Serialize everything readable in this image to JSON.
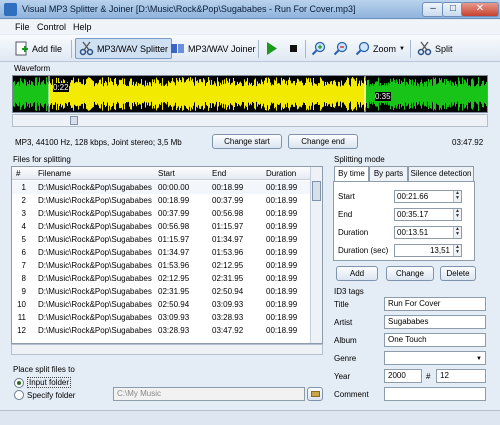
{
  "window": {
    "title": "Visual MP3 Splitter & Joiner [D:\\Music\\Rock&Pop\\Sugababes - Run For Cover.mp3]",
    "minimize": "–",
    "maximize": "□",
    "close": "✕"
  },
  "menu": [
    "File",
    "Control",
    "Help"
  ],
  "toolbar": {
    "add_file": "Add file",
    "splitter": "MP3/WAV Splitter",
    "joiner": "MP3/WAV Joiner",
    "zoom": "Zoom",
    "split": "Split"
  },
  "waveform": {
    "label": "Waveform",
    "start_marker": "0:22",
    "end_marker": "0:35",
    "selection_start_fraction": 0.075,
    "selection_end_fraction": 0.743,
    "colors": {
      "background": "#000000",
      "selected": "#f2ea00",
      "unselected": "#19c419"
    }
  },
  "info": {
    "format": "MP3, 44100 Hz, 128 kbps, Joint stereo; 3,5 Mb",
    "change_start": "Change start",
    "change_end": "Change end",
    "total": "03:47.92"
  },
  "files": {
    "label": "Files for splitting",
    "columns": [
      "#",
      "Filename",
      "Start",
      "End",
      "Duration"
    ],
    "rows": [
      [
        "1",
        "D:\\Music\\Rock&Pop\\Sugababes",
        "00:00.00",
        "00:18.99",
        "00:18.99"
      ],
      [
        "2",
        "D:\\Music\\Rock&Pop\\Sugababes",
        "00:18.99",
        "00:37.99",
        "00:18.99"
      ],
      [
        "3",
        "D:\\Music\\Rock&Pop\\Sugababes",
        "00:37.99",
        "00:56.98",
        "00:18.99"
      ],
      [
        "4",
        "D:\\Music\\Rock&Pop\\Sugababes",
        "00:56.98",
        "01:15.97",
        "00:18.99"
      ],
      [
        "5",
        "D:\\Music\\Rock&Pop\\Sugababes",
        "01:15.97",
        "01:34.97",
        "00:18.99"
      ],
      [
        "6",
        "D:\\Music\\Rock&Pop\\Sugababes",
        "01:34.97",
        "01:53.96",
        "00:18.99"
      ],
      [
        "7",
        "D:\\Music\\Rock&Pop\\Sugababes",
        "01:53.96",
        "02:12.95",
        "00:18.99"
      ],
      [
        "8",
        "D:\\Music\\Rock&Pop\\Sugababes",
        "02:12.95",
        "02:31.95",
        "00:18.99"
      ],
      [
        "9",
        "D:\\Music\\Rock&Pop\\Sugababes",
        "02:31.95",
        "02:50.94",
        "00:18.99"
      ],
      [
        "10",
        "D:\\Music\\Rock&Pop\\Sugababes",
        "02:50.94",
        "03:09.93",
        "00:18.99"
      ],
      [
        "11",
        "D:\\Music\\Rock&Pop\\Sugababes",
        "03:09.93",
        "03:28.93",
        "00:18.99"
      ],
      [
        "12",
        "D:\\Music\\Rock&Pop\\Sugababes",
        "03:28.93",
        "03:47.92",
        "00:18.99"
      ]
    ]
  },
  "splitting": {
    "label": "Splitting mode",
    "tabs": [
      "By time",
      "By parts",
      "Silence detection"
    ],
    "start_label": "Start",
    "start_value": "00:21.66",
    "end_label": "End",
    "end_value": "00:35.17",
    "duration_label": "Duration",
    "duration_value": "00:13.51",
    "duration_sec_label": "Duration (sec)",
    "duration_sec_value": "13,51",
    "add": "Add",
    "change": "Change",
    "delete": "Delete"
  },
  "id3": {
    "label": "ID3 tags",
    "title_label": "Title",
    "title_value": "Run For Cover",
    "artist_label": "Artist",
    "artist_value": "Sugababes",
    "album_label": "Album",
    "album_value": "One Touch",
    "genre_label": "Genre",
    "genre_value": "",
    "year_label": "Year",
    "year_value": "2000",
    "track_label": "#",
    "track_value": "12",
    "comment_label": "Comment",
    "comment_value": ""
  },
  "output": {
    "label": "Place split files to",
    "input_folder": "Input folder",
    "specify_folder": "Specify folder",
    "folder_path": "C:\\My Music"
  }
}
